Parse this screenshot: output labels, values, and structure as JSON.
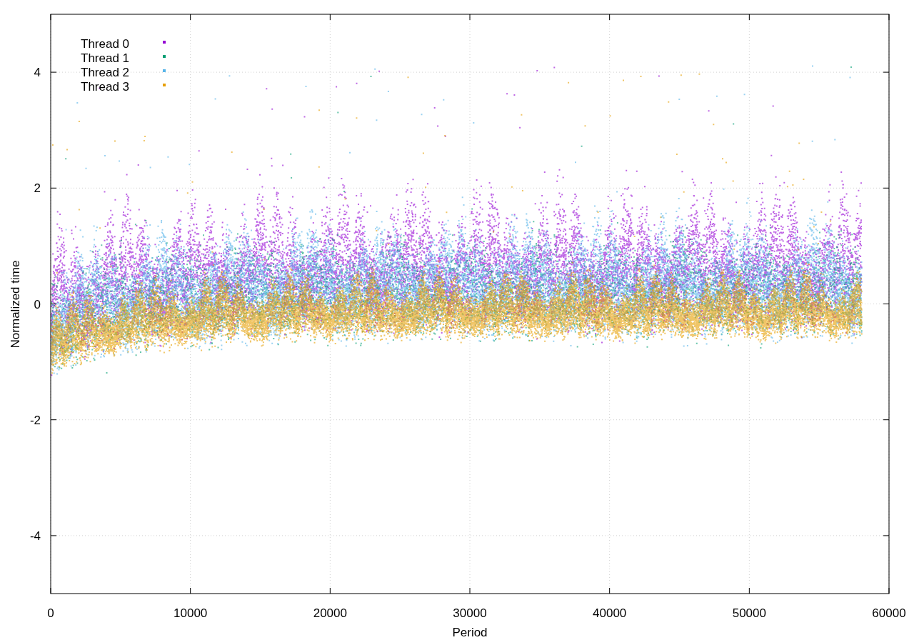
{
  "plot": {
    "x_axis": {
      "label": "Period",
      "tick_labels": [
        "0",
        "10000",
        "20000",
        "30000",
        "40000",
        "50000",
        "60000"
      ]
    },
    "y_axis": {
      "label": "Normalized time",
      "tick_labels": [
        "4",
        "2",
        "0",
        "-2",
        "-4"
      ]
    },
    "legend": [
      {
        "label": "Thread 0",
        "color": "#9400d3"
      },
      {
        "label": "Thread 1",
        "color": "#009e73"
      },
      {
        "label": "Thread 2",
        "color": "#56b4e9"
      },
      {
        "label": "Thread 3",
        "color": "#e69f00"
      }
    ]
  }
}
